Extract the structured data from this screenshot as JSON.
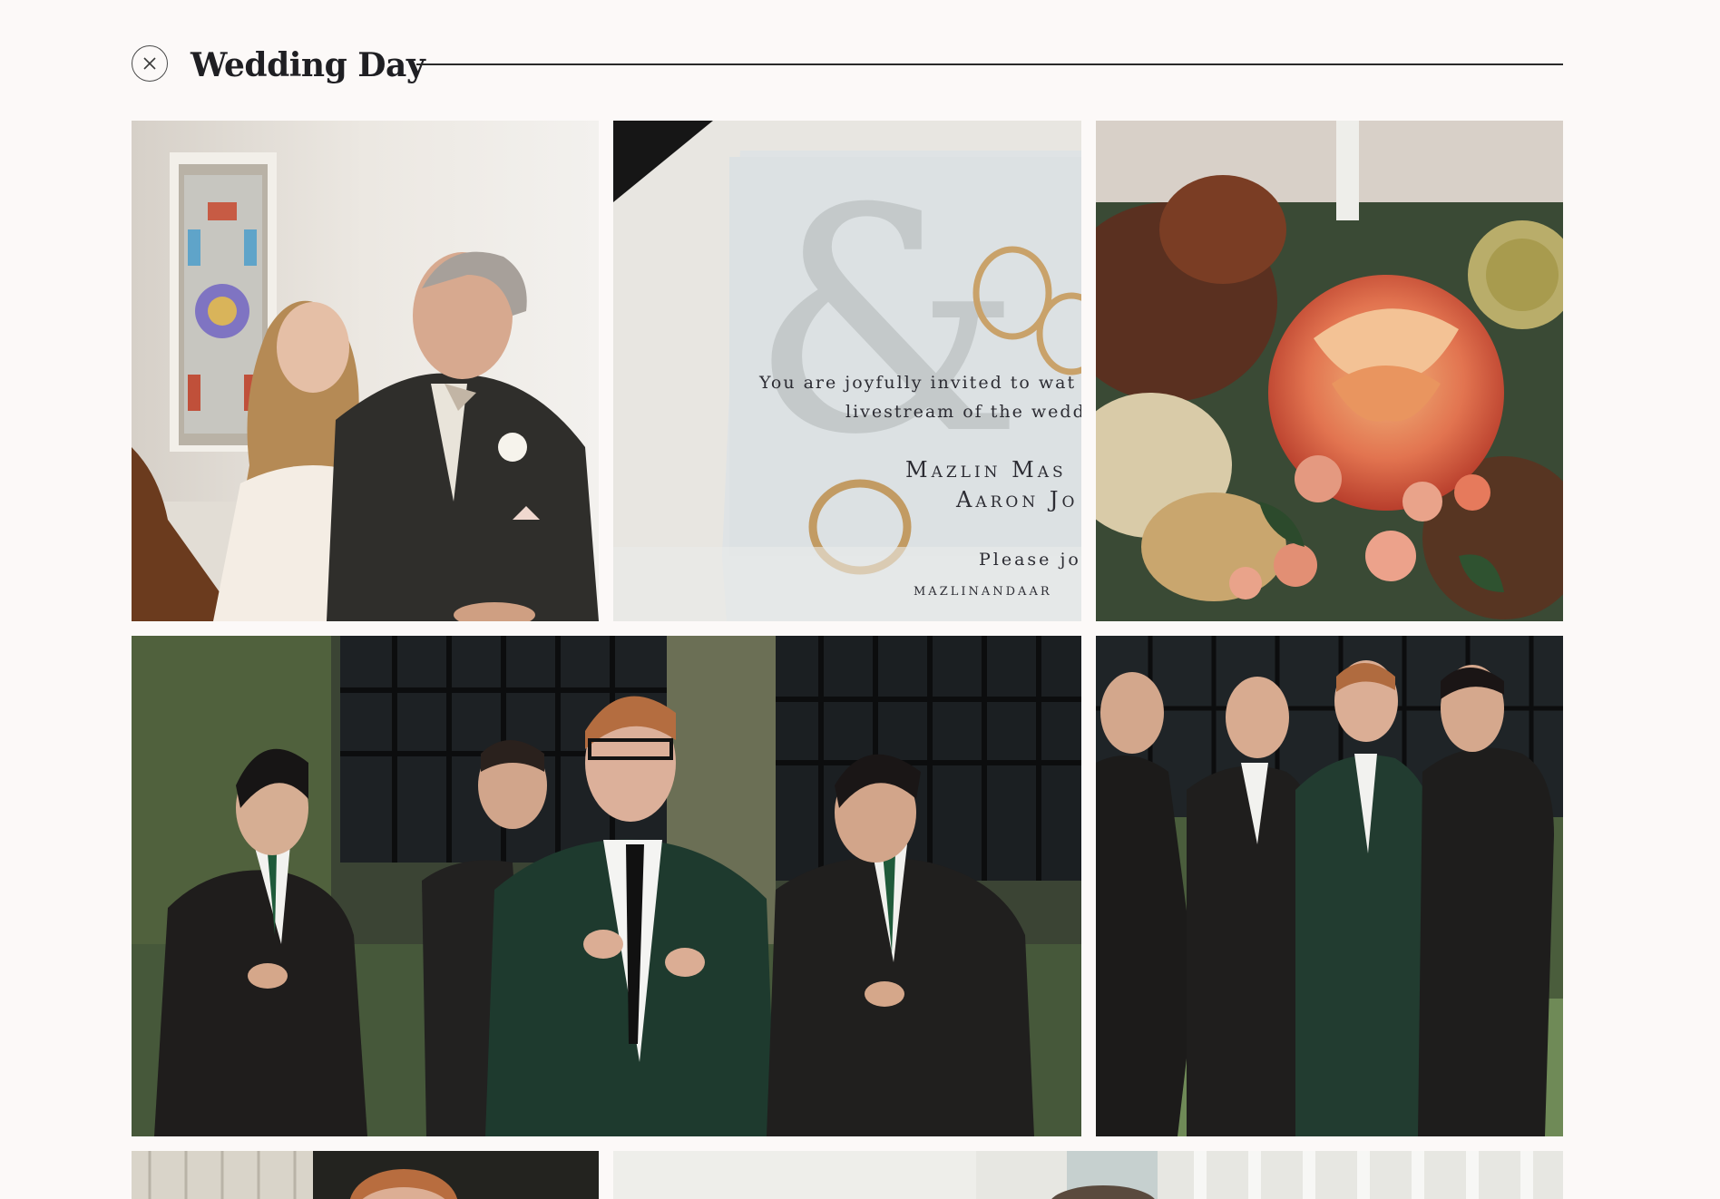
{
  "gallery": {
    "title": "Wedding Day",
    "close_icon": "close-x-icon"
  },
  "photos": [
    {
      "subject": "bride-and-father-photo"
    },
    {
      "subject": "invitation-and-rings-photo"
    },
    {
      "subject": "bouquet-photo"
    },
    {
      "subject": "groom-and-groomsmen-photo"
    },
    {
      "subject": "groomsmen-laughing-photo"
    },
    {
      "subject": "groomsman-portrait-photo"
    },
    {
      "subject": "staircase-photo"
    }
  ],
  "invitation": {
    "line1": "You are joyfully invited to wat",
    "line2": "livestream of the wedd",
    "name1": "Mazlin Mas",
    "name2": "Aaron Jo",
    "please": "Please jo",
    "site": "MAZLINANDAAR"
  },
  "colors": {
    "background": "#fcf9f8",
    "title": "#1f1f23",
    "rule": "#2a2a2a"
  }
}
